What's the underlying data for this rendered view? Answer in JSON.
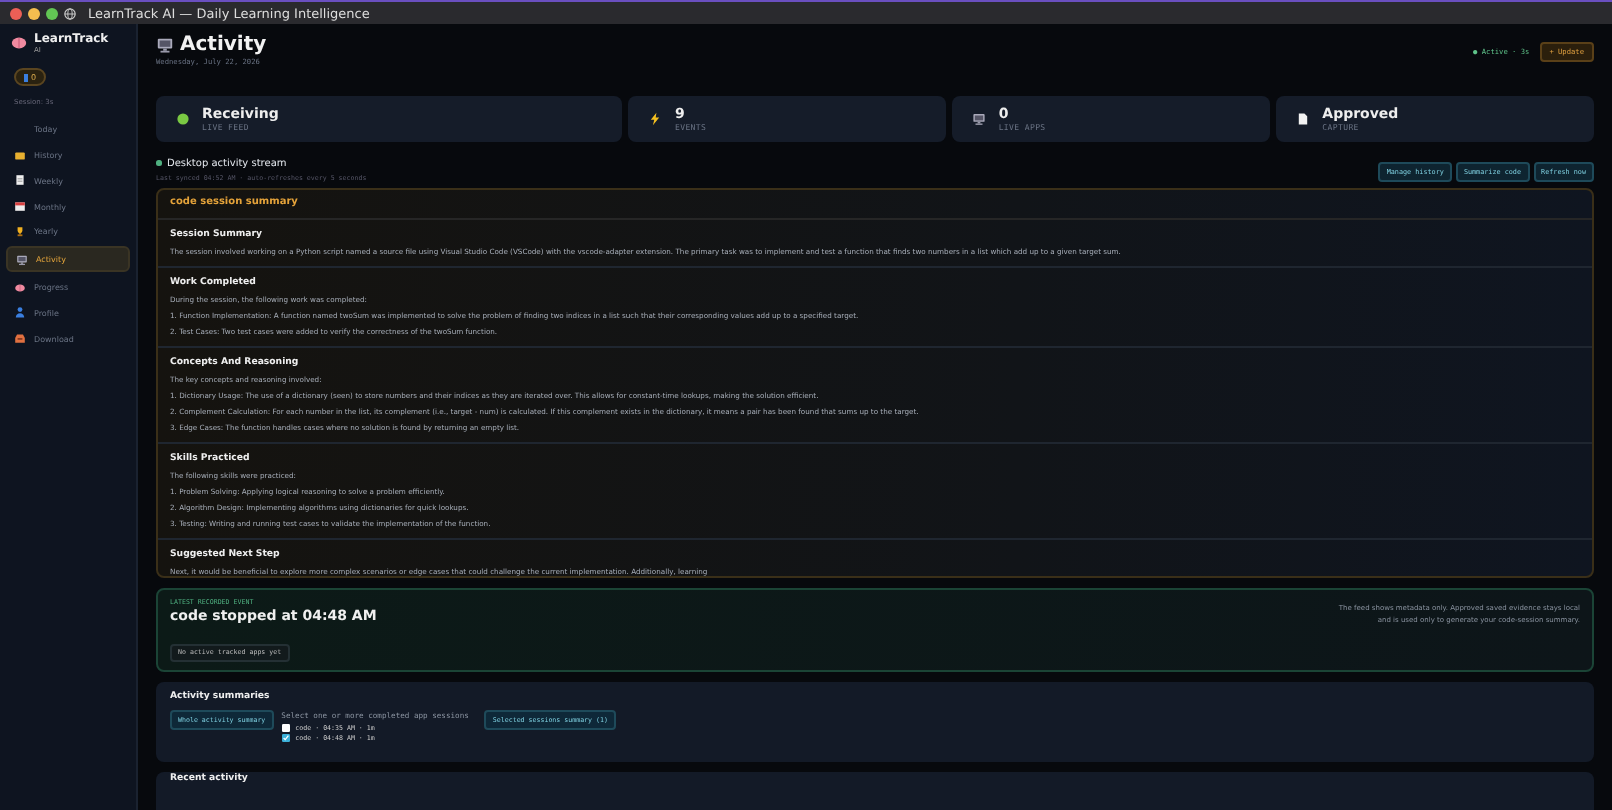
{
  "window": {
    "title": "LearnTrack AI — Daily Learning Intelligence"
  },
  "sidebar": {
    "brand": "LearnTrack",
    "brand_sub": "AI",
    "badge": "0",
    "session": "Session: 3s",
    "items": [
      {
        "label": "Today",
        "kind": "plain",
        "selected": false
      },
      {
        "label": "History",
        "kind": "folder",
        "selected": false
      },
      {
        "label": "Weekly",
        "kind": "notepad",
        "selected": false
      },
      {
        "label": "Monthly",
        "kind": "calendar",
        "selected": false
      },
      {
        "label": "Yearly",
        "kind": "trophy",
        "selected": false
      },
      {
        "label": "Activity",
        "kind": "monitor",
        "selected": true
      },
      {
        "label": "Progress",
        "kind": "brain",
        "selected": false
      },
      {
        "label": "Profile",
        "kind": "person",
        "selected": false
      },
      {
        "label": "Download",
        "kind": "inbox",
        "selected": false
      }
    ]
  },
  "header": {
    "title": "Activity",
    "date": "Wednesday, July 22, 2026",
    "status": "● Active · 3s",
    "update_button": "+ Update"
  },
  "stats": [
    {
      "value": "Receiving",
      "label": "LIVE FEED",
      "kind": "feed"
    },
    {
      "value": "9",
      "label": "EVENTS",
      "kind": "bolt"
    },
    {
      "value": "0",
      "label": "LIVE APPS",
      "kind": "monitor"
    },
    {
      "value": "Approved",
      "label": "CAPTURE",
      "kind": "page"
    }
  ],
  "stream": {
    "title": "Desktop activity stream",
    "subtitle": "Last synced 04:52 AM · auto-refreshes every 5 seconds",
    "buttons": [
      "Manage history",
      "Summarize code",
      "Refresh now"
    ]
  },
  "summary": {
    "title": "code session summary",
    "sections": [
      {
        "heading": "Session Summary",
        "lines": [
          "The session involved working on a Python script named a source file using Visual Studio Code (VSCode) with the vscode-adapter extension. The primary task was to implement and test a function that finds two numbers in a list which add up to a given target sum."
        ]
      },
      {
        "heading": "Work Completed",
        "lines": [
          "During the session, the following work was completed:",
          "1. Function Implementation: A function named twoSum was implemented to solve the problem of finding two indices in a list such that their corresponding values add up to a specified target.",
          "2. Test Cases: Two test cases were added to verify the correctness of the twoSum function."
        ]
      },
      {
        "heading": "Concepts And Reasoning",
        "lines": [
          "The key concepts and reasoning involved:",
          "1. Dictionary Usage: The use of a dictionary (seen) to store numbers and their indices as they are iterated over. This allows for constant-time lookups, making the solution efficient.",
          "2. Complement Calculation: For each number in the list, its complement (i.e., target - num) is calculated. If this complement exists in the dictionary, it means a pair has been found that sums up to the target.",
          "3. Edge Cases: The function handles cases where no solution is found by returning an empty list."
        ]
      },
      {
        "heading": "Skills Practiced",
        "lines": [
          "The following skills were practiced:",
          "1. Problem Solving: Applying logical reasoning to solve a problem efficiently.",
          "2. Algorithm Design: Implementing algorithms using dictionaries for quick lookups.",
          "3. Testing: Writing and running test cases to validate the implementation of the function."
        ]
      },
      {
        "heading": "Suggested Next Step",
        "lines": [
          "Next, it would be beneficial to explore more complex scenarios or edge cases that could challenge the current implementation. Additionally, learning"
        ]
      }
    ]
  },
  "latest_event": {
    "label": "LATEST RECORDED EVENT",
    "title": "code stopped at 04:48 AM",
    "chip": "No active tracked apps yet",
    "note": "The feed shows metadata only. Approved saved evidence stays local and is used only to generate your code-session summary."
  },
  "activity_summaries": {
    "title": "Activity summaries",
    "whole_button": "Whole activity summary",
    "hint": "Select one or more completed app sessions",
    "sessions": [
      {
        "label": "code · 04:35 AM · 1m",
        "checked": false
      },
      {
        "label": "code · 04:48 AM · 1m",
        "checked": true
      }
    ],
    "selected_button": "Selected sessions summary (1)"
  },
  "recent_activity": {
    "title": "Recent activity"
  }
}
